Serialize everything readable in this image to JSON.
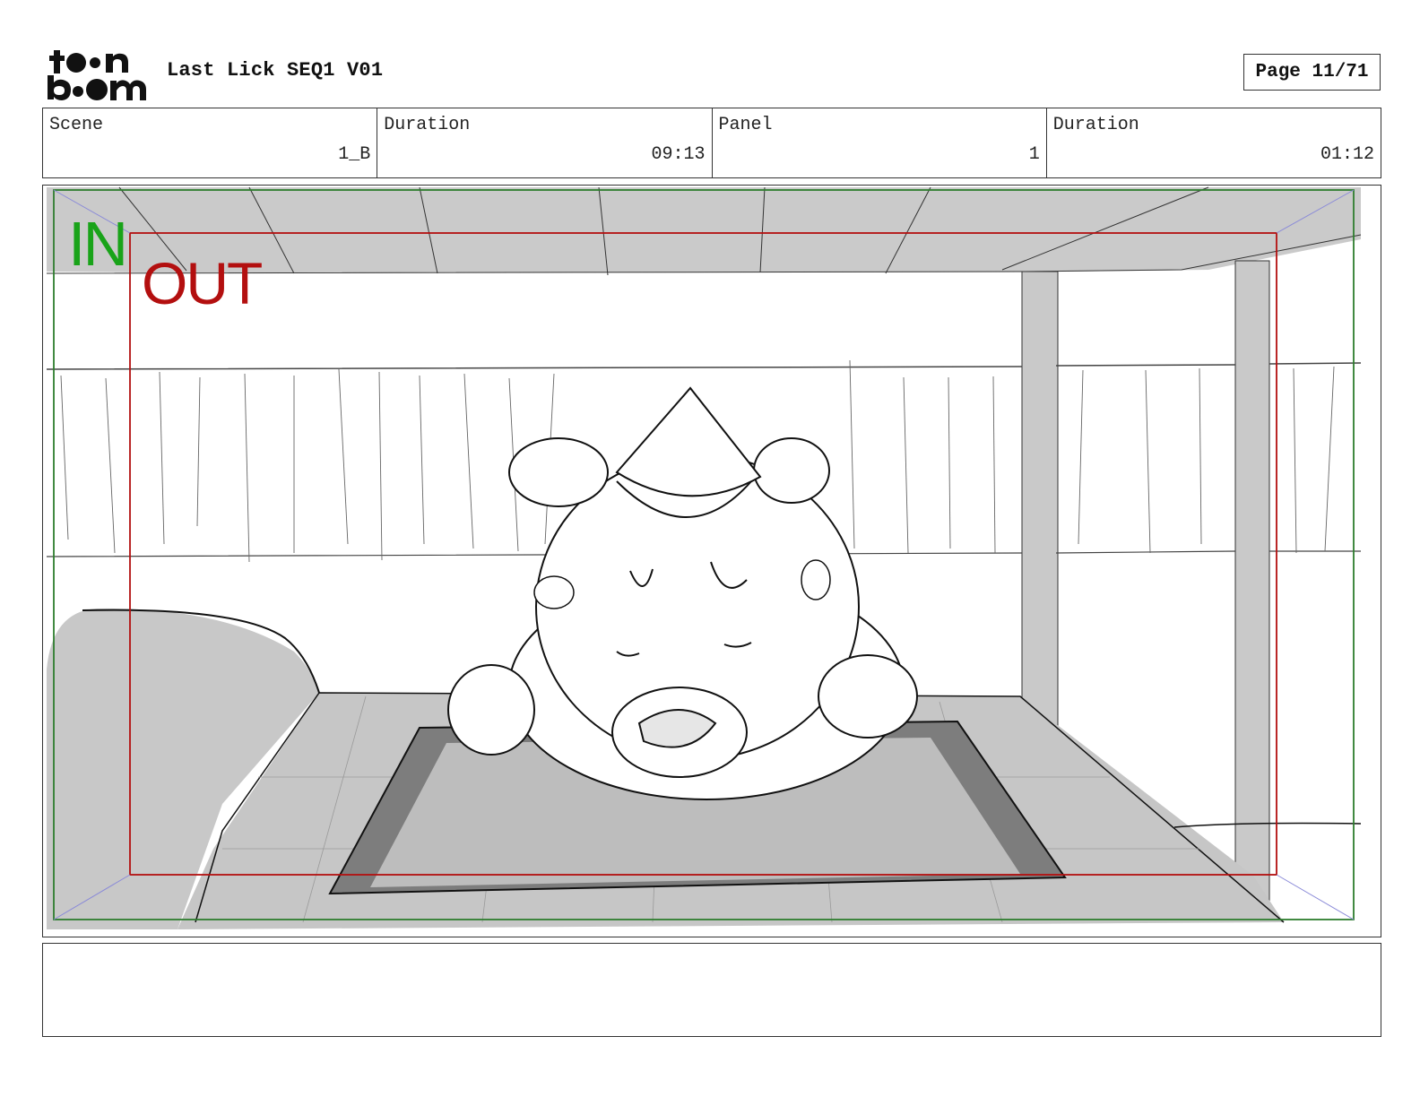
{
  "header": {
    "logo_text": "toon boom",
    "project_title": "Last Lick SEQ1 V01",
    "page_label": "Page 11/71"
  },
  "info_bar": {
    "scene_label": "Scene",
    "scene_value": "1_B",
    "scene_duration_label": "Duration",
    "scene_duration_value": "09:13",
    "panel_label": "Panel",
    "panel_value": "1",
    "panel_duration_label": "Duration",
    "panel_duration_value": "01:12"
  },
  "panel": {
    "safe_frame_in_label": "IN",
    "safe_frame_out_label": "OUT",
    "in_color": "#19a319",
    "out_color": "#b30f0f"
  },
  "notes": {
    "dialogue": "",
    "action": ""
  }
}
